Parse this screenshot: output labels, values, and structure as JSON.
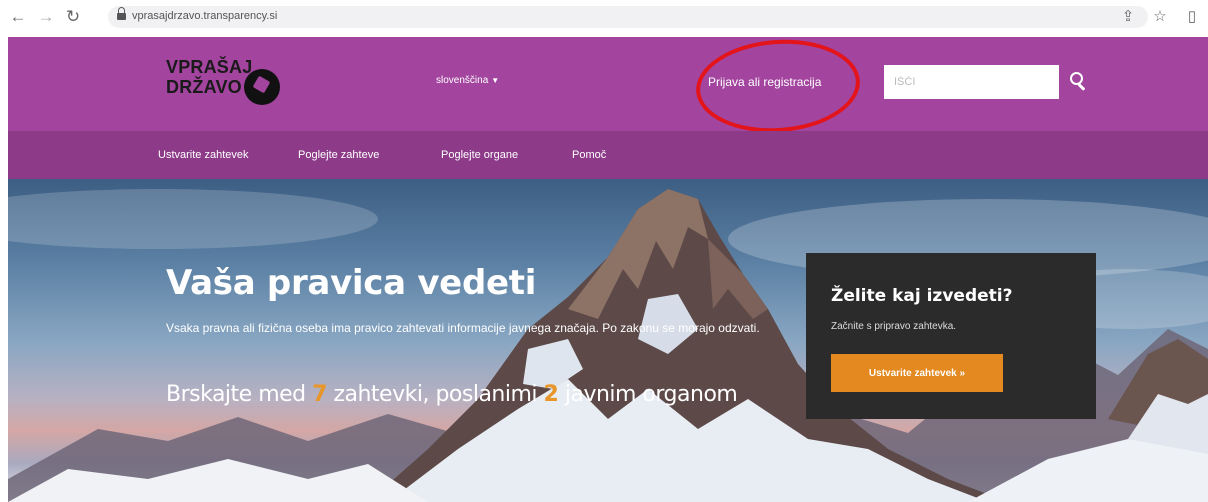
{
  "browser": {
    "url": "vprasajdrzavo.transparency.si",
    "icons": [
      "back-arrow-icon",
      "forward-arrow-icon",
      "reload-icon",
      "lock-icon",
      "share-icon",
      "star-icon",
      "sidebar-icon"
    ]
  },
  "header": {
    "logo_line1": "VPRAŠAJ",
    "logo_line2": "DRŽAVO",
    "language": "slovenščina",
    "login_label": "Prijava ali registracija",
    "search_placeholder": "IŠČI",
    "colors": {
      "header": "#a3449f",
      "subnav": "#8d3b89",
      "highlight": "#e3141a"
    }
  },
  "nav": {
    "items": [
      {
        "label": "Ustvarite zahtevek"
      },
      {
        "label": "Poglejte zahteve"
      },
      {
        "label": "Poglejte organe"
      },
      {
        "label": "Pomoč"
      }
    ]
  },
  "hero": {
    "title": "Vaša pravica vedeti",
    "lead": "Vsaka pravna ali fizična oseba ima pravico zahtevati informacije javnega značaja. Po zakonu se morajo odzvati.",
    "stats_pre": "Brskajte med",
    "requests_count": "7",
    "stats_mid": "zahtevki, poslanimi",
    "bodies_count": "2",
    "stats_post": "javnim organom",
    "accent_color": "#e8962a"
  },
  "cta": {
    "title": "Želite kaj izvedeti?",
    "subtitle": "Začnite s pripravo zahtevka.",
    "button_label": "Ustvarite zahtevek »",
    "button_color": "#e3891f"
  }
}
